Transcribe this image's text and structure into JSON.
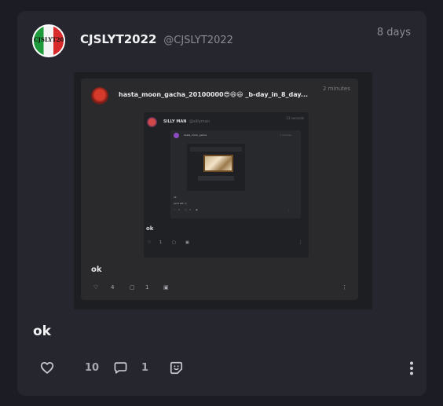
{
  "post": {
    "author_name": "CJSLYT2022",
    "author_handle": "@CJSLYT2022",
    "timestamp": "8 days",
    "avatar_text": "CJSLYT2022",
    "body": "ok",
    "likes": "10",
    "comments": "1"
  },
  "quoted_screenshot": {
    "author": "hasta_moon_gacha_20100000😎😄😃 _b-day_in_8_day...",
    "timestamp": "2 minutes",
    "body": "ok",
    "likes": "4",
    "comments": "1",
    "nested": {
      "author_name": "SILLY MAN",
      "author_handle": "@sillyman",
      "timestamp": "13 seconds",
      "body": "ok",
      "likes": "1",
      "inner": {
        "author": "hasta_moon_gacha",
        "timestamp": "2 minutes",
        "line1": "ok",
        "line2": "(and wtf :/)",
        "likes": "1",
        "comments": "1"
      }
    }
  },
  "colors": {
    "background": "#1c1d24",
    "card": "#25262e",
    "muted": "#8c8d96"
  }
}
